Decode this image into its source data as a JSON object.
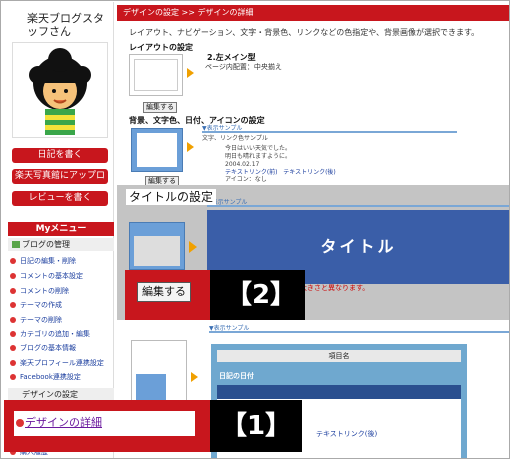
{
  "sidebar": {
    "user_name": "楽天ブログスタッフさん",
    "buttons": [
      "日記を書く",
      "楽天写真館にアップロード",
      "レビューを書く"
    ],
    "menu_header": "Myメニュー",
    "section1_title": "ブログの管理",
    "items": [
      "日記の編集・削除",
      "コメントの基本設定",
      "コメントの削除",
      "テーマの作成",
      "テーマの削除",
      "カテゴリの追加・編集",
      "ブログの基本情報",
      "楽天プロフィール連携設定",
      "Facebook連携設定"
    ],
    "section2_title": "デザインの設定",
    "detail_link": "デザインの詳細",
    "last_item": "購入履歴"
  },
  "main": {
    "breadcrumb": "デザインの設定 >> デザインの詳細",
    "description": "レイアウト、ナビゲーション、文字・背景色、リンクなどの色指定や、背景画像が選択できます。",
    "layout_section": {
      "title": "レイアウトの設定",
      "name": "2.左メイン型",
      "align": "ページ内配置：中央揃え",
      "edit_label": "編集する"
    },
    "bg_section": {
      "title": "背景、文字色、日付、アイコンの設定",
      "sample_label": "▼表示サンプル",
      "sample_text": "文字、リンク色サンプル",
      "sample_line1": "今日はいい天気でした。",
      "sample_line2": "明日も晴れますように。",
      "sample_date": "2004.02.17",
      "link_before": "テキストリンク(前)",
      "link_after": "テキストリンク(後)",
      "icon_text": "アイコン：なし",
      "edit_label": "編集する"
    },
    "title_section": {
      "title": "タイトルの設定",
      "sample_label": "▼表示サンプル",
      "preview_text": "タイトル",
      "note": "の大きさと異なります。",
      "edit_label": "編集する"
    },
    "lower_section": {
      "sample_label": "▼表示サンプル",
      "header": "項目名",
      "sub": "日記の日付",
      "link": "テキストリンク(後)"
    }
  },
  "callouts": {
    "one": "【1】",
    "two": "【2】"
  },
  "colors": {
    "brand_red": "#c8161d",
    "title_blue": "#3a5ea8",
    "link_blue": "#1a3d9e"
  }
}
